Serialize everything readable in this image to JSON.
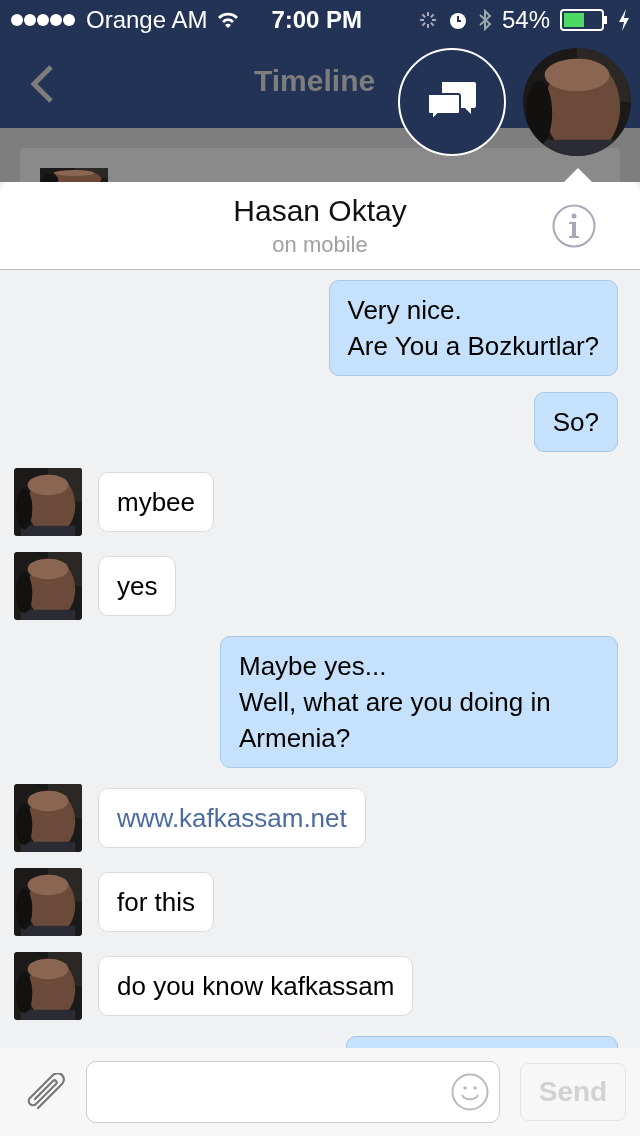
{
  "status_bar": {
    "carrier": "Orange AM",
    "time": "7:00 PM",
    "battery": "54%"
  },
  "nav": {
    "title": "Timeline"
  },
  "chat": {
    "name": "Hasan Oktay",
    "presence": "on mobile"
  },
  "messages": [
    {
      "kind": "outgoing",
      "text": "Very nice.\nAre You a Bozkurtlar?",
      "link": false
    },
    {
      "kind": "outgoing",
      "text": "So?",
      "link": false
    },
    {
      "kind": "incoming",
      "text": "mybee",
      "link": false
    },
    {
      "kind": "incoming",
      "text": "yes",
      "link": false
    },
    {
      "kind": "outgoing",
      "text": "Maybe yes...\nWell, what are you doing in Armenia?",
      "link": false
    },
    {
      "kind": "incoming",
      "text": "www.kafkassam.net",
      "link": true
    },
    {
      "kind": "incoming",
      "text": "for this",
      "link": false
    },
    {
      "kind": "incoming",
      "text": "do you know kafkassam",
      "link": false
    },
    {
      "kind": "partial"
    }
  ],
  "composer": {
    "send": {
      "label": "Send",
      "disabled": true
    }
  }
}
